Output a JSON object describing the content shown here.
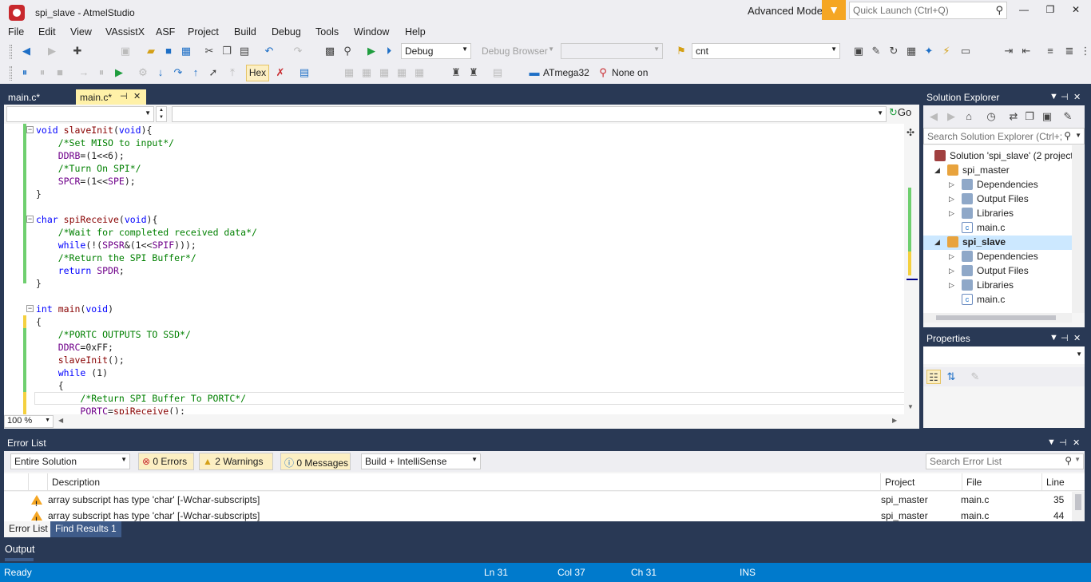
{
  "window": {
    "title": "spi_slave - AtmelStudio",
    "mode_label": "Advanced Mode",
    "quick_launch_placeholder": "Quick Launch (Ctrl+Q)"
  },
  "menu": [
    "File",
    "Edit",
    "View",
    "VAssistX",
    "ASF",
    "Project",
    "Build",
    "Debug",
    "Tools",
    "Window",
    "Help"
  ],
  "toolbar1": {
    "config": "Debug",
    "debug_browser": "Debug Browser",
    "find": "cnt"
  },
  "toolbar2": {
    "hex_label": "Hex",
    "device": "ATmega32",
    "tool": "None on"
  },
  "tabs": [
    {
      "label": "main.c*"
    },
    {
      "label": "main.c*"
    }
  ],
  "nav": {
    "go_label": "Go"
  },
  "code_lines": [
    [
      {
        "t": "void",
        "c": "kw"
      },
      {
        "t": " "
      },
      {
        "t": "slaveInit",
        "c": "fn"
      },
      {
        "t": "("
      },
      {
        "t": "void",
        "c": "kw"
      },
      {
        "t": "){"
      }
    ],
    [
      {
        "t": "    "
      },
      {
        "t": "/*Set MISO to input*/",
        "c": "cm"
      }
    ],
    [
      {
        "t": "    "
      },
      {
        "t": "DDRB",
        "c": "mc"
      },
      {
        "t": "=(1<<"
      },
      {
        "t": "6",
        "c": ""
      },
      {
        "t": ");"
      }
    ],
    [
      {
        "t": "    "
      },
      {
        "t": "/*Turn On SPI*/",
        "c": "cm"
      }
    ],
    [
      {
        "t": "    "
      },
      {
        "t": "SPCR",
        "c": "mc"
      },
      {
        "t": "=(1<<"
      },
      {
        "t": "SPE",
        "c": "mc"
      },
      {
        "t": ");"
      }
    ],
    [
      {
        "t": "}"
      }
    ],
    [
      {
        "t": ""
      }
    ],
    [
      {
        "t": "char",
        "c": "kw"
      },
      {
        "t": " "
      },
      {
        "t": "spiReceive",
        "c": "fn"
      },
      {
        "t": "("
      },
      {
        "t": "void",
        "c": "kw"
      },
      {
        "t": "){"
      }
    ],
    [
      {
        "t": "    "
      },
      {
        "t": "/*Wait for completed received data*/",
        "c": "cm"
      }
    ],
    [
      {
        "t": "    "
      },
      {
        "t": "while",
        "c": "kw"
      },
      {
        "t": "(!("
      },
      {
        "t": "SPSR",
        "c": "mc"
      },
      {
        "t": "&(1<<"
      },
      {
        "t": "SPIF",
        "c": "mc"
      },
      {
        "t": ")));"
      }
    ],
    [
      {
        "t": "    "
      },
      {
        "t": "/*Return the SPI Buffer*/",
        "c": "cm"
      }
    ],
    [
      {
        "t": "    "
      },
      {
        "t": "return",
        "c": "kw"
      },
      {
        "t": " "
      },
      {
        "t": "SPDR",
        "c": "mc"
      },
      {
        "t": ";"
      }
    ],
    [
      {
        "t": "}"
      }
    ],
    [
      {
        "t": ""
      }
    ],
    [
      {
        "t": "int",
        "c": "kw"
      },
      {
        "t": " "
      },
      {
        "t": "main",
        "c": "fn"
      },
      {
        "t": "("
      },
      {
        "t": "void",
        "c": "kw"
      },
      {
        "t": ")"
      }
    ],
    [
      {
        "t": "{"
      }
    ],
    [
      {
        "t": "    "
      },
      {
        "t": "/*PORTC OUTPUTS TO SSD*/",
        "c": "cm"
      }
    ],
    [
      {
        "t": "    "
      },
      {
        "t": "DDRC",
        "c": "mc"
      },
      {
        "t": "=0xFF;"
      }
    ],
    [
      {
        "t": "    "
      },
      {
        "t": "slaveInit",
        "c": "fn"
      },
      {
        "t": "();"
      }
    ],
    [
      {
        "t": "    "
      },
      {
        "t": "while",
        "c": "kw"
      },
      {
        "t": " (1)"
      }
    ],
    [
      {
        "t": "    {"
      }
    ],
    [
      {
        "t": "        "
      },
      {
        "t": "/*Return SPI Buffer To PORTC*/",
        "c": "cm"
      }
    ],
    [
      {
        "t": "        "
      },
      {
        "t": "PORTC",
        "c": "mc"
      },
      {
        "t": "="
      },
      {
        "t": "spiReceive",
        "c": "fn"
      },
      {
        "t": "();"
      }
    ]
  ],
  "editor": {
    "zoom": "100 %"
  },
  "solution_explorer": {
    "title": "Solution Explorer",
    "search_placeholder": "Search Solution Explorer (Ctrl+;",
    "tree": [
      {
        "label": "Solution 'spi_slave' (2 project",
        "level": 0,
        "expander": "",
        "icon": "solution",
        "bold": false
      },
      {
        "label": "spi_master",
        "level": 1,
        "expander": "◢",
        "icon": "project",
        "bold": false
      },
      {
        "label": "Dependencies",
        "level": 2,
        "expander": "▷",
        "icon": "folder",
        "bold": false
      },
      {
        "label": "Output Files",
        "level": 2,
        "expander": "▷",
        "icon": "folder",
        "bold": false
      },
      {
        "label": "Libraries",
        "level": 2,
        "expander": "▷",
        "icon": "folder",
        "bold": false
      },
      {
        "label": "main.c",
        "level": 2,
        "expander": "",
        "icon": "cfile",
        "bold": false
      },
      {
        "label": "spi_slave",
        "level": 1,
        "expander": "◢",
        "icon": "project",
        "bold": true
      },
      {
        "label": "Dependencies",
        "level": 2,
        "expander": "▷",
        "icon": "folder",
        "bold": false
      },
      {
        "label": "Output Files",
        "level": 2,
        "expander": "▷",
        "icon": "folder",
        "bold": false
      },
      {
        "label": "Libraries",
        "level": 2,
        "expander": "▷",
        "icon": "folder",
        "bold": false
      },
      {
        "label": "main.c",
        "level": 2,
        "expander": "",
        "icon": "cfile",
        "bold": false
      }
    ]
  },
  "properties": {
    "title": "Properties"
  },
  "error_list": {
    "title": "Error List",
    "scope": "Entire Solution",
    "errors": "0 Errors",
    "warnings": "2 Warnings",
    "messages": "0 Messages",
    "source": "Build + IntelliSense",
    "search_placeholder": "Search Error List",
    "columns": [
      "Description",
      "Project",
      "File",
      "Line"
    ],
    "rows": [
      {
        "description": "array subscript has type 'char' [-Wchar-subscripts]",
        "project": "spi_master",
        "file": "main.c",
        "line": "35"
      },
      {
        "description": "array subscript has type 'char' [-Wchar-subscripts]",
        "project": "spi_master",
        "file": "main.c",
        "line": "44"
      }
    ],
    "tabs": [
      "Error List",
      "Find Results 1"
    ]
  },
  "output_tab": "Output",
  "status": {
    "state": "Ready",
    "ln": "Ln 31",
    "col": "Col 37",
    "ch": "Ch 31",
    "ins": "INS"
  },
  "colors": {
    "chrome": "#eeeef2",
    "frame": "#293955",
    "accent": "#007acc",
    "tab_active": "#fff1a8",
    "warning": "#f5a623"
  }
}
